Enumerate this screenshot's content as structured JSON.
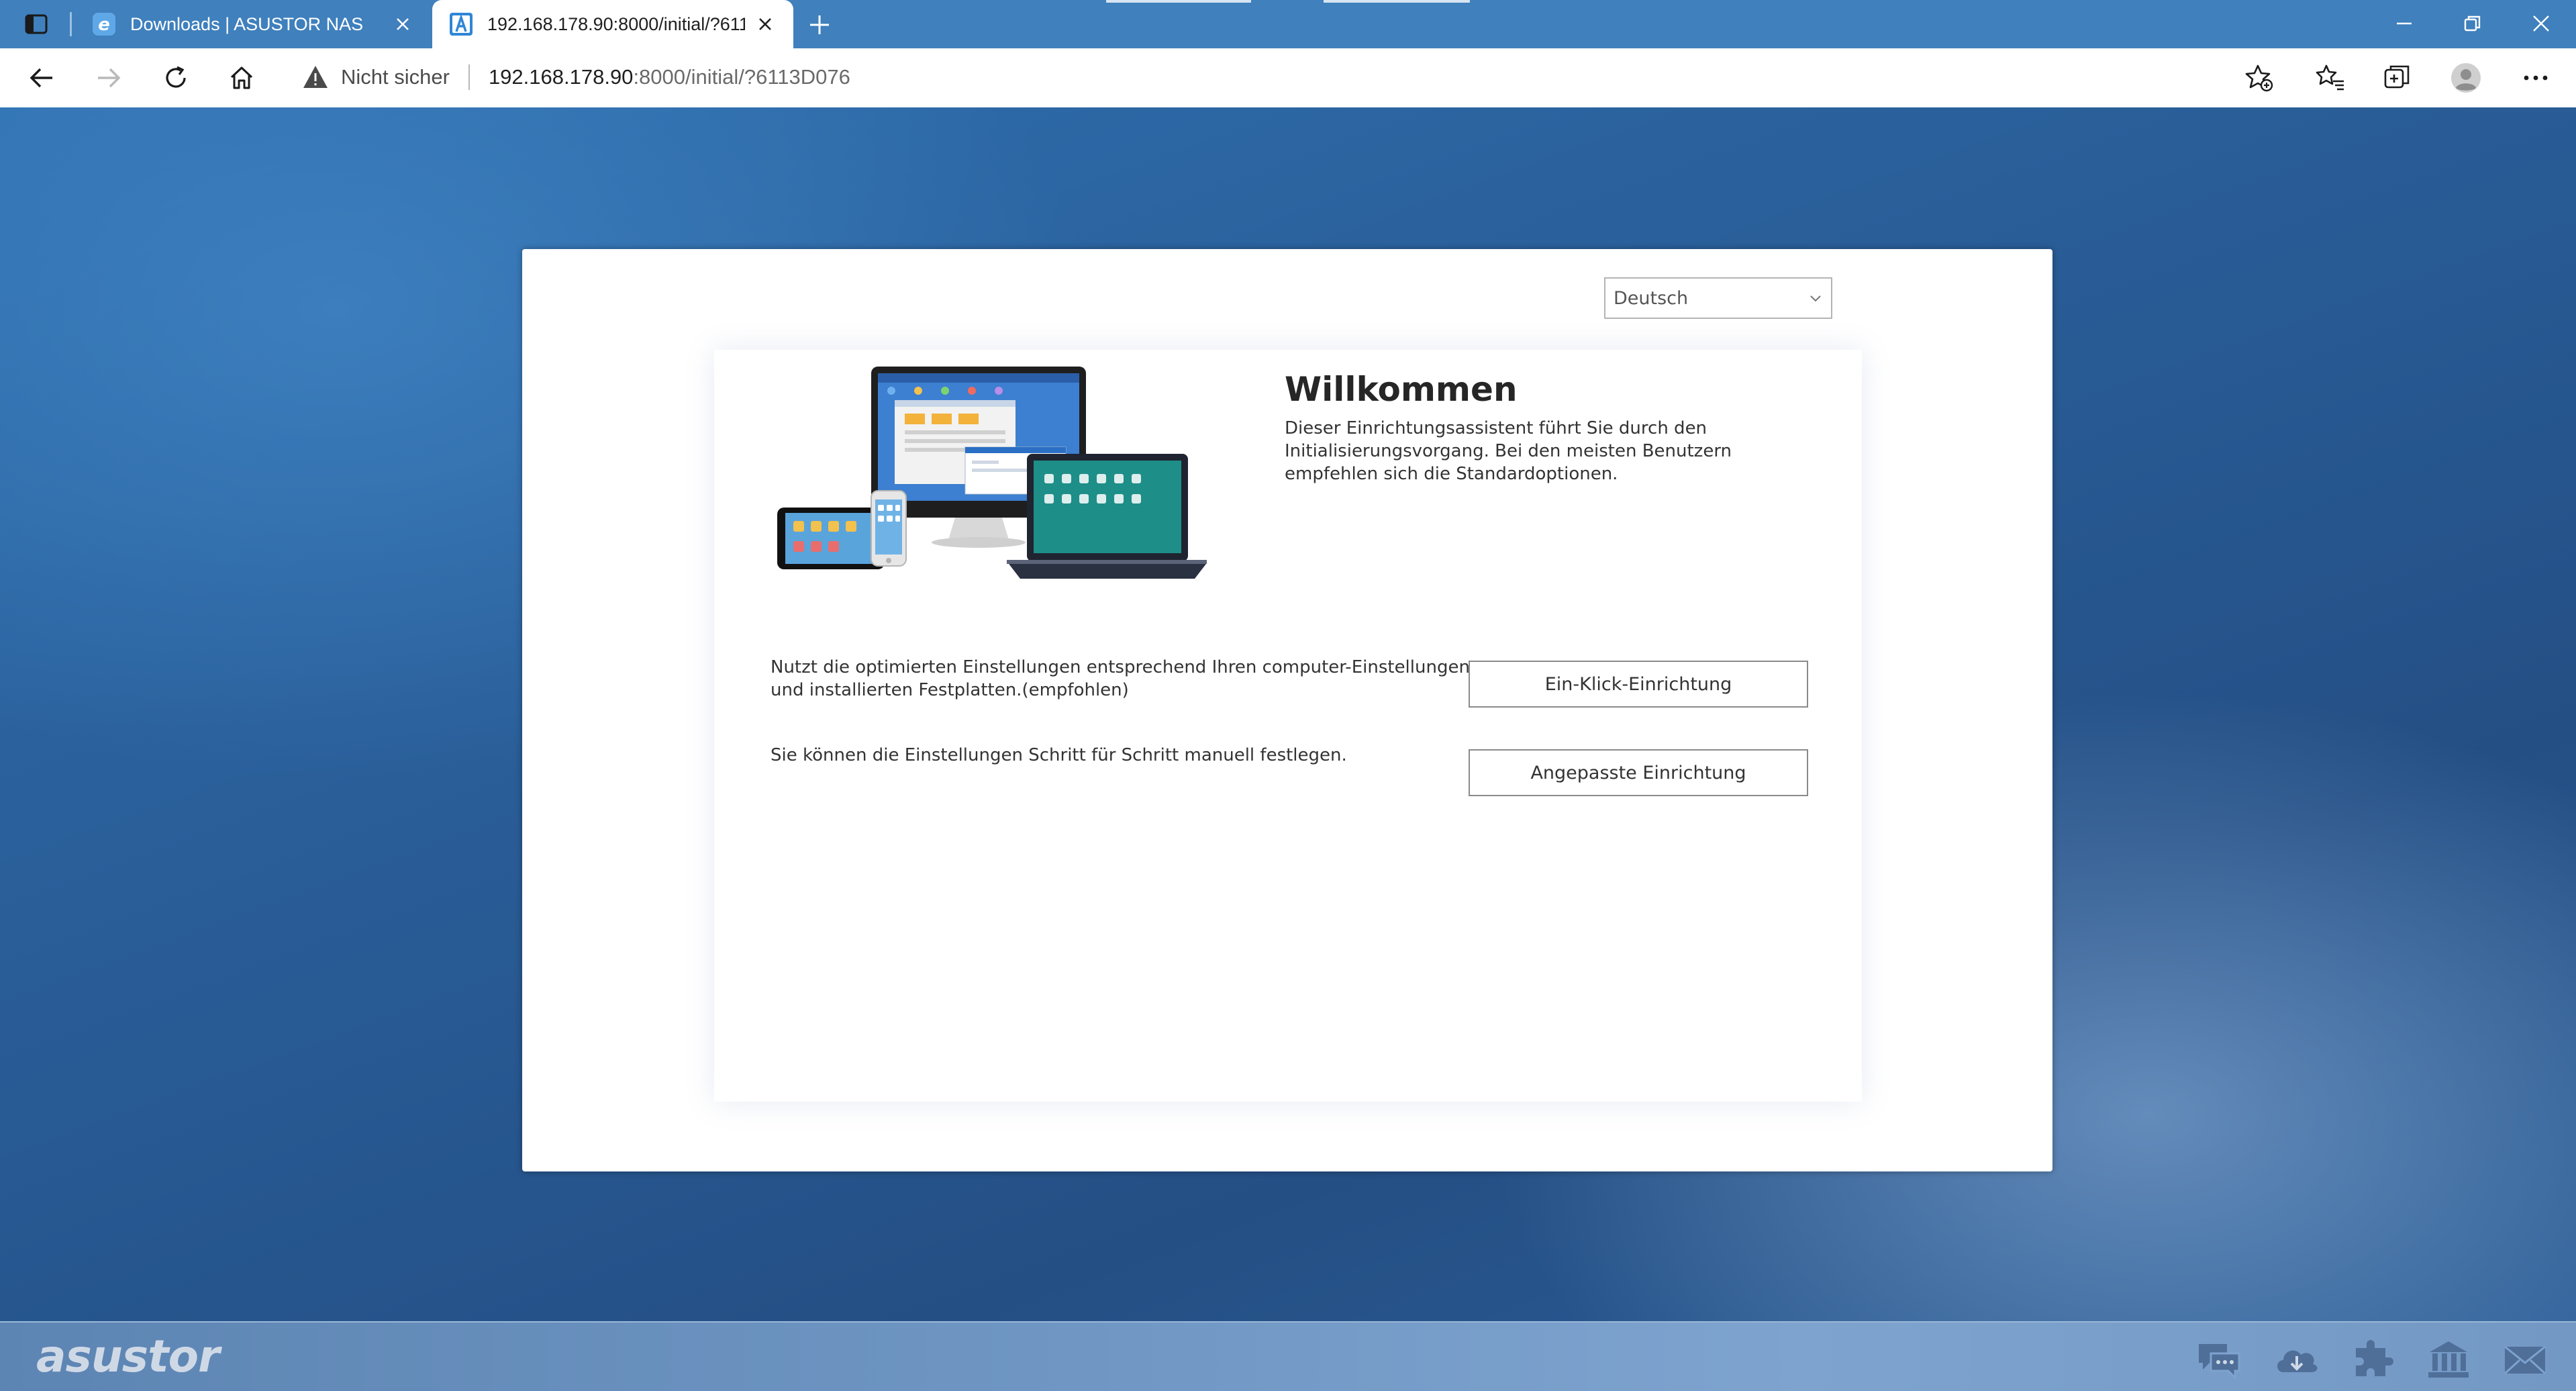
{
  "browser": {
    "tabs": [
      {
        "title": "Downloads | ASUSTOR NAS",
        "favicon": "asustor-e-icon",
        "active": false
      },
      {
        "title": "192.168.178.90:8000/initial/?611",
        "favicon": "asustor-a-icon",
        "active": true
      }
    ],
    "address": {
      "security_label": "Nicht sicher",
      "url_host": "192.168.178.90",
      "url_path": ":8000/initial/?6113D076"
    }
  },
  "setup": {
    "language": "Deutsch",
    "title": "Willkommen",
    "description": "Dieser Einrichtungsassistent führt Sie durch den Initialisierungsvorgang. Bei den meisten Benutzern empfehlen sich die Standardoptionen.",
    "options": [
      {
        "text": "Nutzt die optimierten Einstellungen entsprechend Ihren computer-Einstellungen und installierten Festplatten.(empfohlen)",
        "button": "Ein-Klick-Einrichtung"
      },
      {
        "text": "Sie können die Einstellungen Schritt für Schritt manuell festlegen.",
        "button": "Angepasste Einrichtung"
      }
    ]
  },
  "footer": {
    "brand": "asustor",
    "icons": [
      "chat-icon",
      "cloud-download-icon",
      "plugin-icon",
      "bank-icon",
      "mail-icon"
    ]
  },
  "colors": {
    "tabbar": "#3f80bd",
    "page_background": "#2a5f9a",
    "dialog": "#ffffff",
    "bottombar": "#6f96c3"
  }
}
